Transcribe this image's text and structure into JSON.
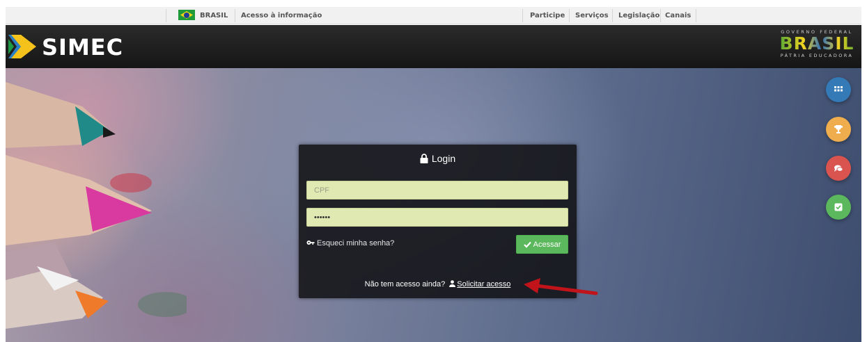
{
  "gov_bar": {
    "country": "BRASIL",
    "info_link": "Acesso à informação",
    "links": [
      "Participe",
      "Serviços",
      "Legislação",
      "Canais"
    ]
  },
  "header": {
    "app_name": "SIMEC",
    "gov_logo": {
      "top": "GOVERNO FEDERAL",
      "word": "BRASIL",
      "bottom": "PÁTRIA EDUCADORA"
    }
  },
  "login": {
    "title": "Login",
    "cpf_placeholder": "CPF",
    "password_value": "••••••",
    "forgot_label": "Esqueci minha senha?",
    "submit_label": "Acessar",
    "no_access_text": "Não tem acesso ainda?",
    "request_access_label": "Solicitar acesso"
  },
  "side_buttons": [
    {
      "icon": "grid-icon",
      "color": "#337ab7"
    },
    {
      "icon": "trophy-icon",
      "color": "#f0ad4e"
    },
    {
      "icon": "comments-icon",
      "color": "#d9534f"
    },
    {
      "icon": "check-square-icon",
      "color": "#5cb85c"
    }
  ],
  "colors": {
    "header_bg": "#1e1e1e",
    "field_bg": "#e1e9b3",
    "success": "#5cb85c",
    "arrow": "#c0141a"
  }
}
